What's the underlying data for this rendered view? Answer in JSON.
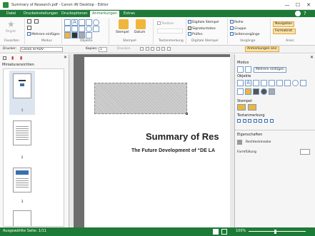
{
  "window": {
    "title": "Summary of Research.pdf - Canon iW Desktop - Editor",
    "controls": [
      "—",
      "☐",
      "✕"
    ]
  },
  "tabs": [
    {
      "label": "Datei"
    },
    {
      "label": "Druckeinstellungen"
    },
    {
      "label": "Druckoptionen"
    },
    {
      "label": "Anmerkungen"
    },
    {
      "label": "Extras"
    }
  ],
  "ribbon": {
    "favoriten": {
      "label": "Favoriten",
      "regist": "Regist."
    },
    "modus": {
      "label": "Modus",
      "mehrere": "Mehrere einfügen"
    },
    "objekte": {
      "label": "Objekte"
    },
    "stempel": {
      "label": "Stempel",
      "stempel_btn": "Stempel",
      "datum_btn": "Datum"
    },
    "textanmerkung": {
      "label": "Textanmerkung",
      "textbox": "Textbox"
    },
    "digitale": {
      "label": "Digitale Stempel",
      "dstempel": "Digitale Stempel",
      "signaturstatus": "Signaturstatus",
      "pruefen": "Prüfen"
    },
    "vorgaenge": {
      "label": "Vorgänge",
      "reihe": "Reihe",
      "gruppe": "Gruppe",
      "seitenvorgaenge": "Seitenvorgänge"
    },
    "ansic": {
      "label": "Ansic",
      "navigation": "Navigation",
      "formatinst": "Formatinst."
    }
  },
  "toolbar": {
    "drucker_label": "Drucker:",
    "drucker_value": "Canon iR-ADV",
    "kopien_label": "Kopien:",
    "kopien_value": "1",
    "drucken": "Drucken",
    "anmerkungen_anz": "Anmerkungen anz."
  },
  "left_panel": {
    "title": "Miniaturansichten",
    "thumbs": [
      "1",
      "2",
      "3"
    ]
  },
  "document": {
    "heading": "Summary of Res",
    "subheading": "The Future Development of “DE LA"
  },
  "right_panel": {
    "modus_label": "Modus",
    "mehrere": "Mehrere einfügen",
    "objekte_label": "Objekte",
    "stempel_label": "Stempel",
    "textanmerkung_label": "Textanmerkung",
    "eigenschaften_label": "Eigenschaften",
    "rechteckmaske": "Rechteckmaske",
    "formfuellung": "Formfüllung"
  },
  "status": {
    "selected": "Ausgewählte Seite: 1/11",
    "zoom": "100%"
  },
  "colors": {
    "brand": "#1e7a37",
    "accent_orange": "#f0b63c",
    "link_blue": "#3a6fb0"
  }
}
